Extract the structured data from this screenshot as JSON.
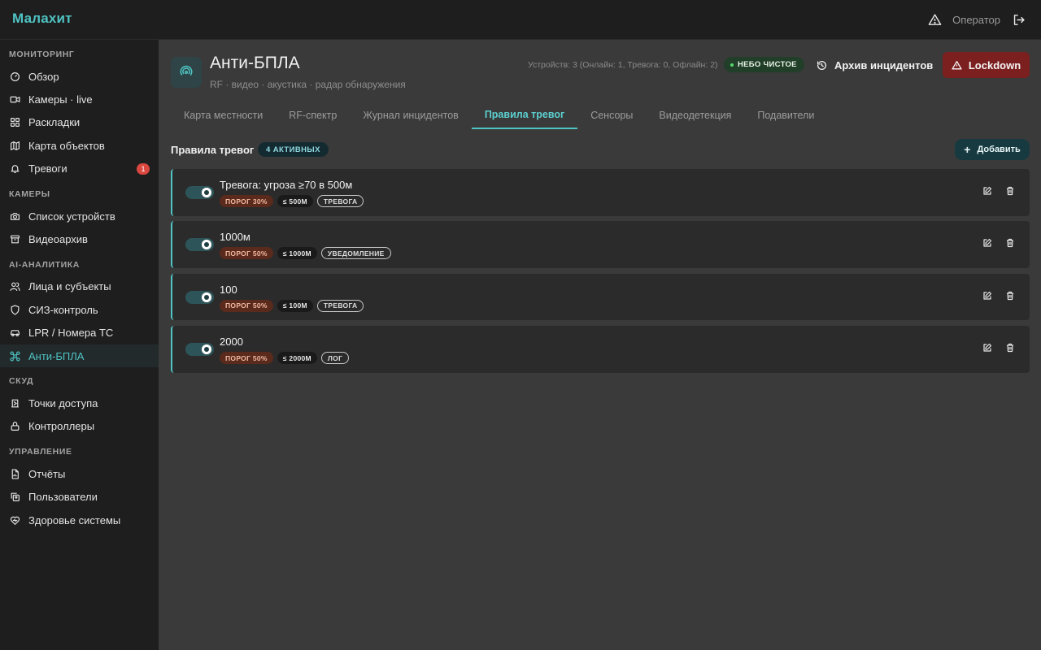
{
  "app": {
    "title": "Малахит",
    "user": "Оператор"
  },
  "sidebar": {
    "sections": [
      {
        "label": "МОНИТОРИНГ",
        "items": [
          {
            "label": "Обзор",
            "icon": "gauge-icon"
          },
          {
            "label": "Камеры · live",
            "icon": "video-icon"
          },
          {
            "label": "Раскладки",
            "icon": "grid-icon"
          },
          {
            "label": "Карта объектов",
            "icon": "map-icon"
          },
          {
            "label": "Тревоги",
            "icon": "bell-icon",
            "badge": "1"
          }
        ]
      },
      {
        "label": "КАМЕРЫ",
        "items": [
          {
            "label": "Список устройств",
            "icon": "camera-icon"
          },
          {
            "label": "Видеоархив",
            "icon": "archive-icon"
          }
        ]
      },
      {
        "label": "AI-АНАЛИТИКА",
        "items": [
          {
            "label": "Лица и субъекты",
            "icon": "users-icon"
          },
          {
            "label": "СИЗ-контроль",
            "icon": "shield-icon"
          },
          {
            "label": "LPR / Номера ТС",
            "icon": "car-icon"
          },
          {
            "label": "Анти-БПЛА",
            "icon": "drone-icon",
            "active": true
          }
        ]
      },
      {
        "label": "СКУД",
        "items": [
          {
            "label": "Точки доступа",
            "icon": "door-icon"
          },
          {
            "label": "Контроллеры",
            "icon": "lock-icon"
          }
        ]
      },
      {
        "label": "УПРАВЛЕНИЕ",
        "items": [
          {
            "label": "Отчёты",
            "icon": "report-icon"
          },
          {
            "label": "Пользователи",
            "icon": "user-copy-icon"
          },
          {
            "label": "Здоровье системы",
            "icon": "heart-icon"
          }
        ]
      }
    ]
  },
  "header": {
    "title": "Анти-БПЛА",
    "subtitle": "RF · видео · акустика · радар обнаружения",
    "devices": "Устройств: 3 (Онлайн: 1, Тревога: 0, Офлайн: 2)",
    "sky_status": "НЕБО ЧИСТОЕ",
    "archive_label": "Архив инцидентов",
    "lockdown_label": "Lockdown"
  },
  "tabs": [
    {
      "label": "Карта местности"
    },
    {
      "label": "RF-спектр"
    },
    {
      "label": "Журнал инцидентов"
    },
    {
      "label": "Правила тревог",
      "active": true
    },
    {
      "label": "Сенсоры"
    },
    {
      "label": "Видеодетекция"
    },
    {
      "label": "Подавители"
    }
  ],
  "rules_section": {
    "title": "Правила тревог",
    "active_count": "4 АКТИВНЫХ",
    "add_label": "Добавить"
  },
  "rules": [
    {
      "name": "Тревога: угроза ≥70 в 500м",
      "threshold": "ПОРОГ 30%",
      "distance": "≤ 500М",
      "action": "ТРЕВОГА",
      "enabled": true
    },
    {
      "name": "1000м",
      "threshold": "ПОРОГ 50%",
      "distance": "≤ 1000М",
      "action": "УВЕДОМЛЕНИЕ",
      "enabled": true
    },
    {
      "name": "100",
      "threshold": "ПОРОГ 50%",
      "distance": "≤ 100М",
      "action": "ТРЕВОГА",
      "enabled": true
    },
    {
      "name": "2000",
      "threshold": "ПОРОГ 50%",
      "distance": "≤ 2000М",
      "action": "ЛОГ",
      "enabled": true
    }
  ],
  "colors": {
    "accent": "#4fc3c3",
    "danger": "#7c1f1f",
    "ok": "#56d86e"
  }
}
